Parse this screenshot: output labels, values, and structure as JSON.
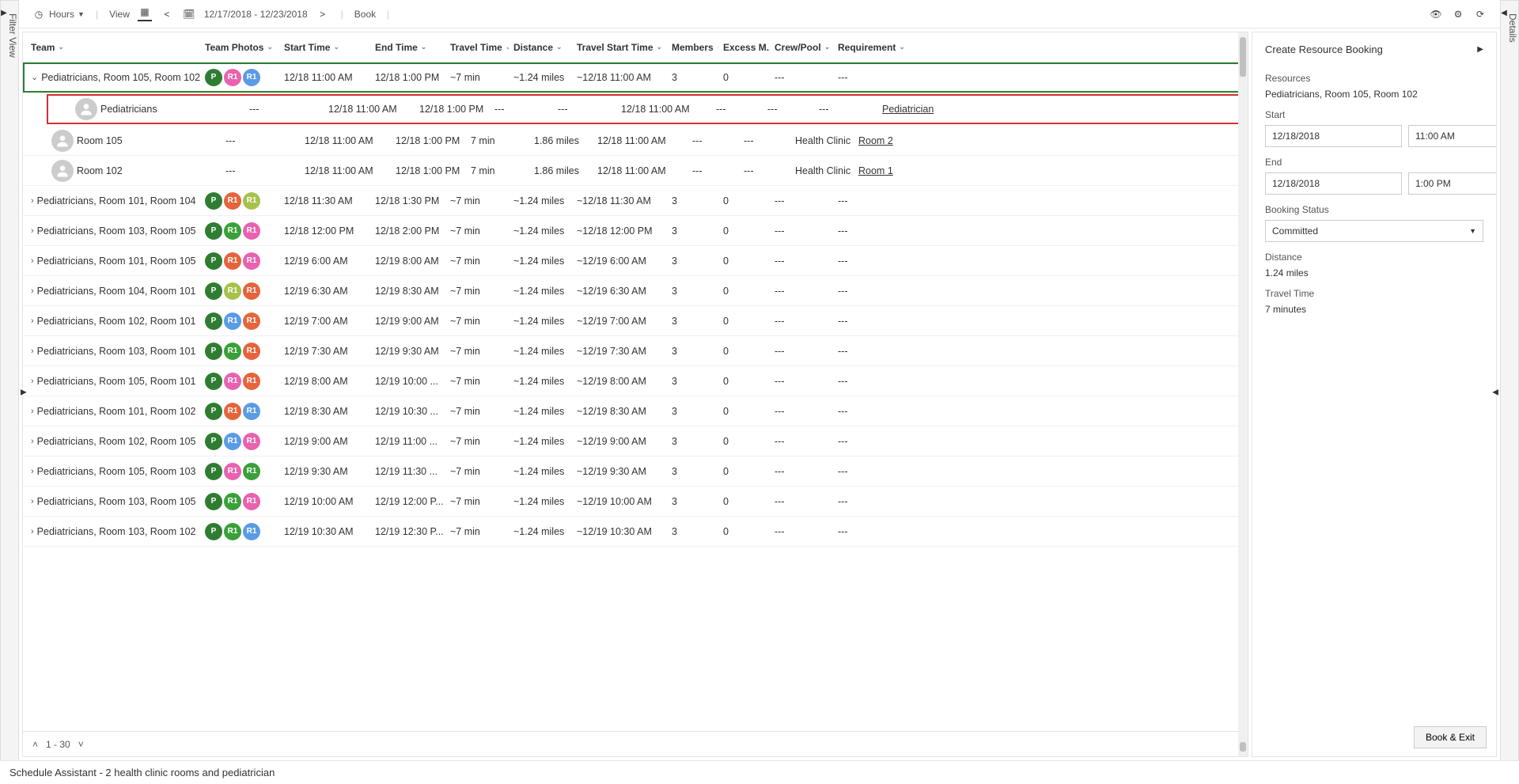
{
  "vertical_tabs": {
    "left": "Filter View",
    "right": "Details"
  },
  "toolbar": {
    "hours_label": "Hours",
    "view_label": "View",
    "date_range": "12/17/2018 - 12/23/2018",
    "book_label": "Book"
  },
  "columns": [
    "Team",
    "Team Photos",
    "Start Time",
    "End Time",
    "Travel Time",
    "Distance",
    "Travel Start Time",
    "Members",
    "Excess M...",
    "Crew/Pool",
    "Requirement"
  ],
  "badge_colors": {
    "P_green": "#2e7d32",
    "R1_pink": "#e862b0",
    "R1_blue": "#5a9be6",
    "R1_orange": "#e6643c",
    "R1_lime": "#a6c24a",
    "R1_green": "#3aa03a"
  },
  "rows": [
    {
      "type": "parent",
      "expanded": true,
      "selected": true,
      "team": "Pediatricians, Room 105, Room 102",
      "badges": [
        [
          "P",
          "P_green"
        ],
        [
          "R1",
          "R1_pink"
        ],
        [
          "R1",
          "R1_blue"
        ]
      ],
      "start": "12/18 11:00 AM",
      "end": "12/18 1:00 PM",
      "travel": "~7 min",
      "dist": "~1.24 miles",
      "tstart": "~12/18 11:00 AM",
      "members": "3",
      "excess": "0",
      "crew": "---",
      "req": "---"
    },
    {
      "type": "child",
      "highlight": true,
      "team": "Pediatricians",
      "avatar": true,
      "photos": "---",
      "start": "12/18 11:00 AM",
      "end": "12/18 1:00 PM",
      "travel": "---",
      "dist": "---",
      "tstart": "12/18 11:00 AM",
      "members": "---",
      "excess": "---",
      "crew": "---",
      "req": "Pediatrician",
      "reqLink": true
    },
    {
      "type": "child",
      "team": "Room 105",
      "avatar": true,
      "photos": "---",
      "start": "12/18 11:00 AM",
      "end": "12/18 1:00 PM",
      "travel": "7 min",
      "dist": "1.86 miles",
      "tstart": "12/18 11:00 AM",
      "members": "---",
      "excess": "---",
      "crew": "Health Clinic",
      "req": "Room 2",
      "reqLink": true
    },
    {
      "type": "child",
      "team": "Room 102",
      "avatar": true,
      "photos": "---",
      "start": "12/18 11:00 AM",
      "end": "12/18 1:00 PM",
      "travel": "7 min",
      "dist": "1.86 miles",
      "tstart": "12/18 11:00 AM",
      "members": "---",
      "excess": "---",
      "crew": "Health Clinic",
      "req": "Room 1",
      "reqLink": true
    },
    {
      "type": "parent",
      "team": "Pediatricians, Room 101, Room 104",
      "badges": [
        [
          "P",
          "P_green"
        ],
        [
          "R1",
          "R1_orange"
        ],
        [
          "R1",
          "R1_lime"
        ]
      ],
      "start": "12/18 11:30 AM",
      "end": "12/18 1:30 PM",
      "travel": "~7 min",
      "dist": "~1.24 miles",
      "tstart": "~12/18 11:30 AM",
      "members": "3",
      "excess": "0",
      "crew": "---",
      "req": "---"
    },
    {
      "type": "parent",
      "team": "Pediatricians, Room 103, Room 105",
      "badges": [
        [
          "P",
          "P_green"
        ],
        [
          "R1",
          "R1_green"
        ],
        [
          "R1",
          "R1_pink"
        ]
      ],
      "start": "12/18 12:00 PM",
      "end": "12/18 2:00 PM",
      "travel": "~7 min",
      "dist": "~1.24 miles",
      "tstart": "~12/18 12:00 PM",
      "members": "3",
      "excess": "0",
      "crew": "---",
      "req": "---"
    },
    {
      "type": "parent",
      "team": "Pediatricians, Room 101, Room 105",
      "badges": [
        [
          "P",
          "P_green"
        ],
        [
          "R1",
          "R1_orange"
        ],
        [
          "R1",
          "R1_pink"
        ]
      ],
      "start": "12/19 6:00 AM",
      "end": "12/19 8:00 AM",
      "travel": "~7 min",
      "dist": "~1.24 miles",
      "tstart": "~12/19 6:00 AM",
      "members": "3",
      "excess": "0",
      "crew": "---",
      "req": "---"
    },
    {
      "type": "parent",
      "team": "Pediatricians, Room 104, Room 101",
      "badges": [
        [
          "P",
          "P_green"
        ],
        [
          "R1",
          "R1_lime"
        ],
        [
          "R1",
          "R1_orange"
        ]
      ],
      "start": "12/19 6:30 AM",
      "end": "12/19 8:30 AM",
      "travel": "~7 min",
      "dist": "~1.24 miles",
      "tstart": "~12/19 6:30 AM",
      "members": "3",
      "excess": "0",
      "crew": "---",
      "req": "---"
    },
    {
      "type": "parent",
      "team": "Pediatricians, Room 102, Room 101",
      "badges": [
        [
          "P",
          "P_green"
        ],
        [
          "R1",
          "R1_blue"
        ],
        [
          "R1",
          "R1_orange"
        ]
      ],
      "start": "12/19 7:00 AM",
      "end": "12/19 9:00 AM",
      "travel": "~7 min",
      "dist": "~1.24 miles",
      "tstart": "~12/19 7:00 AM",
      "members": "3",
      "excess": "0",
      "crew": "---",
      "req": "---"
    },
    {
      "type": "parent",
      "team": "Pediatricians, Room 103, Room 101",
      "badges": [
        [
          "P",
          "P_green"
        ],
        [
          "R1",
          "R1_green"
        ],
        [
          "R1",
          "R1_orange"
        ]
      ],
      "start": "12/19 7:30 AM",
      "end": "12/19 9:30 AM",
      "travel": "~7 min",
      "dist": "~1.24 miles",
      "tstart": "~12/19 7:30 AM",
      "members": "3",
      "excess": "0",
      "crew": "---",
      "req": "---"
    },
    {
      "type": "parent",
      "team": "Pediatricians, Room 105, Room 101",
      "badges": [
        [
          "P",
          "P_green"
        ],
        [
          "R1",
          "R1_pink"
        ],
        [
          "R1",
          "R1_orange"
        ]
      ],
      "start": "12/19 8:00 AM",
      "end": "12/19 10:00 ...",
      "travel": "~7 min",
      "dist": "~1.24 miles",
      "tstart": "~12/19 8:00 AM",
      "members": "3",
      "excess": "0",
      "crew": "---",
      "req": "---"
    },
    {
      "type": "parent",
      "team": "Pediatricians, Room 101, Room 102",
      "badges": [
        [
          "P",
          "P_green"
        ],
        [
          "R1",
          "R1_orange"
        ],
        [
          "R1",
          "R1_blue"
        ]
      ],
      "start": "12/19 8:30 AM",
      "end": "12/19 10:30 ...",
      "travel": "~7 min",
      "dist": "~1.24 miles",
      "tstart": "~12/19 8:30 AM",
      "members": "3",
      "excess": "0",
      "crew": "---",
      "req": "---"
    },
    {
      "type": "parent",
      "team": "Pediatricians, Room 102, Room 105",
      "badges": [
        [
          "P",
          "P_green"
        ],
        [
          "R1",
          "R1_blue"
        ],
        [
          "R1",
          "R1_pink"
        ]
      ],
      "start": "12/19 9:00 AM",
      "end": "12/19 11:00 ...",
      "travel": "~7 min",
      "dist": "~1.24 miles",
      "tstart": "~12/19 9:00 AM",
      "members": "3",
      "excess": "0",
      "crew": "---",
      "req": "---"
    },
    {
      "type": "parent",
      "team": "Pediatricians, Room 105, Room 103",
      "badges": [
        [
          "P",
          "P_green"
        ],
        [
          "R1",
          "R1_pink"
        ],
        [
          "R1",
          "R1_green"
        ]
      ],
      "start": "12/19 9:30 AM",
      "end": "12/19 11:30 ...",
      "travel": "~7 min",
      "dist": "~1.24 miles",
      "tstart": "~12/19 9:30 AM",
      "members": "3",
      "excess": "0",
      "crew": "---",
      "req": "---"
    },
    {
      "type": "parent",
      "team": "Pediatricians, Room 103, Room 105",
      "badges": [
        [
          "P",
          "P_green"
        ],
        [
          "R1",
          "R1_green"
        ],
        [
          "R1",
          "R1_pink"
        ]
      ],
      "start": "12/19 10:00 AM",
      "end": "12/19 12:00 P...",
      "travel": "~7 min",
      "dist": "~1.24 miles",
      "tstart": "~12/19 10:00 AM",
      "members": "3",
      "excess": "0",
      "crew": "---",
      "req": "---"
    },
    {
      "type": "parent",
      "team": "Pediatricians, Room 103, Room 102",
      "badges": [
        [
          "P",
          "P_green"
        ],
        [
          "R1",
          "R1_green"
        ],
        [
          "R1",
          "R1_blue"
        ]
      ],
      "start": "12/19 10:30 AM",
      "end": "12/19 12:30 P...",
      "travel": "~7 min",
      "dist": "~1.24 miles",
      "tstart": "~12/19 10:30 AM",
      "members": "3",
      "excess": "0",
      "crew": "---",
      "req": "---"
    }
  ],
  "pager": {
    "range": "1 - 30"
  },
  "side_panel": {
    "title": "Create Resource Booking",
    "resources_label": "Resources",
    "resources_value": "Pediatricians, Room 105, Room 102",
    "start_label": "Start",
    "start_date": "12/18/2018",
    "start_time": "11:00 AM",
    "end_label": "End",
    "end_date": "12/18/2018",
    "end_time": "1:00 PM",
    "status_label": "Booking Status",
    "status_value": "Committed",
    "distance_label": "Distance",
    "distance_value": "1.24 miles",
    "travel_label": "Travel Time",
    "travel_value": "7 minutes",
    "book_exit": "Book & Exit"
  },
  "footer": "Schedule Assistant - 2 health clinic rooms and pediatrician"
}
